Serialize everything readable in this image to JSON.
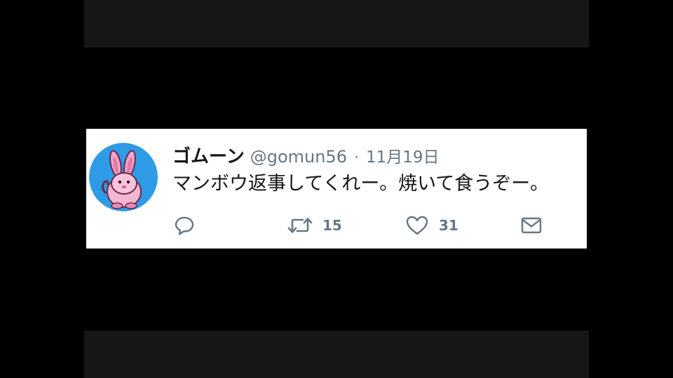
{
  "tweet": {
    "display_name": "ゴムーン",
    "handle": "@gomun56",
    "separator": "·",
    "date": "11月19日",
    "text": "マンボウ返事してくれー。焼いて食うぞー。",
    "avatar_icon": "pink-rabbit-avatar-icon",
    "avatar_bg": "#2e9be6"
  },
  "actions": {
    "reply": {
      "icon": "reply-icon"
    },
    "retweet": {
      "icon": "retweet-icon",
      "count": "15"
    },
    "like": {
      "icon": "heart-icon",
      "count": "31"
    },
    "message": {
      "icon": "envelope-icon"
    }
  },
  "colors": {
    "page_background": "#000000",
    "card_background": "#ffffff",
    "name_color": "#14171a",
    "secondary_color": "#657786"
  }
}
